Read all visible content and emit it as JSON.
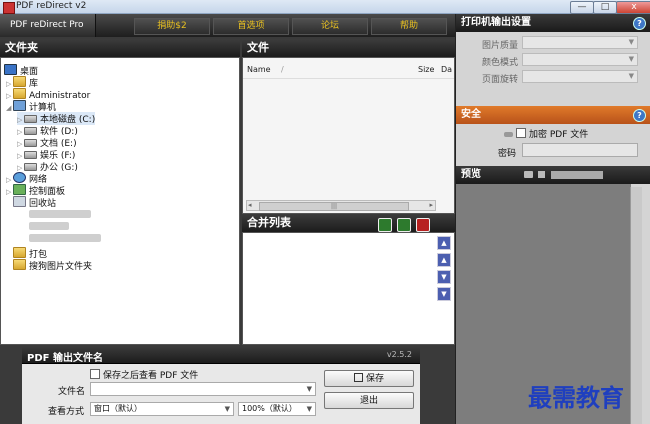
{
  "window": {
    "title": "PDF reDirect v2",
    "buttons": [
      "—",
      "□",
      "x"
    ]
  },
  "toolbar": {
    "brand": "PDF reDirect Pro",
    "nav": [
      "捐助$2",
      "首选项",
      "论坛",
      "帮助"
    ]
  },
  "tree": {
    "header": "文件夹",
    "nodes": [
      {
        "label": "桌面",
        "icon": "desktop-icon"
      },
      {
        "label": "库",
        "icon": "folder-icon"
      },
      {
        "label": "Administrator",
        "icon": "folder-icon"
      },
      {
        "label": "计算机",
        "icon": "computer-icon"
      },
      {
        "label": "本地磁盘 (C:)",
        "icon": "drive-icon"
      },
      {
        "label": "软件 (D:)",
        "icon": "drive-icon"
      },
      {
        "label": "文档 (E:)",
        "icon": "drive-icon"
      },
      {
        "label": "娱乐 (F:)",
        "icon": "drive-icon"
      },
      {
        "label": "办公 (G:)",
        "icon": "drive-icon"
      },
      {
        "label": "网络",
        "icon": "network-icon"
      },
      {
        "label": "控制面板",
        "icon": "control-panel-icon"
      },
      {
        "label": "回收站",
        "icon": "recycle-bin-icon"
      },
      {
        "label": "打包",
        "icon": "folder-icon"
      },
      {
        "label": "搜狗图片文件夹",
        "icon": "folder-icon"
      }
    ]
  },
  "files": {
    "header": "文件",
    "columns": [
      "Name",
      "/",
      "Size",
      "Da"
    ],
    "scroll_grip": "|||"
  },
  "merge": {
    "header": "合并列表",
    "arrows": [
      "▲",
      "▲",
      "▼",
      "▼"
    ]
  },
  "printer": {
    "header": "打印机输出设置",
    "help": "?",
    "props": [
      {
        "label": "图片质量",
        "value": ""
      },
      {
        "label": "颜色模式",
        "value": ""
      },
      {
        "label": "页面旋转",
        "value": ""
      }
    ]
  },
  "security": {
    "header": "安全",
    "help": "?",
    "encrypt_label": "加密 PDF 文件",
    "password_label": "密码"
  },
  "preview": {
    "header": "预览"
  },
  "output": {
    "header": "PDF 输出文件名",
    "version": "v2.5.2",
    "view_after_save": "保存之后查看 PDF 文件",
    "filename_label": "文件名",
    "filename_value": "",
    "view_mode_label": "查看方式",
    "view_mode_value": "窗口（默认）",
    "zoom_value": "100%（默认）",
    "save_button": "保存",
    "exit_button": "退出"
  },
  "watermark": "最需教育"
}
